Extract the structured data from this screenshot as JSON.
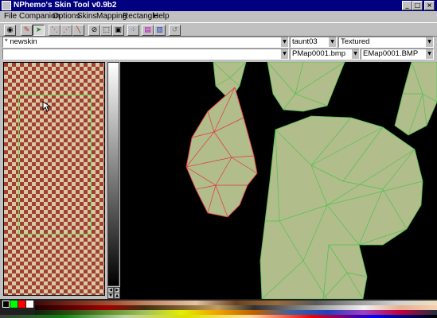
{
  "window": {
    "title": "NPhemo's Skin Tool v0.9b2",
    "minimize_glyph": "_",
    "maximize_glyph": "□",
    "close_glyph": "×"
  },
  "menu": [
    "File",
    "Companion",
    "Options",
    "Skins",
    "Mapping",
    "Rectangle",
    "Help"
  ],
  "toolbar": {
    "buttons": [
      {
        "name": "view-eye-icon",
        "glyph": "◉"
      },
      {
        "name": "paint-tool-icon",
        "glyph": "✎"
      },
      {
        "name": "select-arrow-icon",
        "glyph": "➤"
      },
      {
        "name": "vertex-tool-icon",
        "glyph": "⋱"
      },
      {
        "name": "move-vertex-icon",
        "glyph": "⋰"
      },
      {
        "name": "line-tool-icon",
        "glyph": "╲"
      },
      {
        "name": "link-tool-icon",
        "glyph": "⊘"
      },
      {
        "name": "marquee-icon",
        "glyph": "⬚"
      },
      {
        "name": "image-icon",
        "glyph": "▣"
      },
      {
        "name": "color-picker-icon",
        "glyph": "⁘"
      },
      {
        "name": "front-view-icon",
        "glyph": "▤"
      },
      {
        "name": "back-view-icon",
        "glyph": "▥"
      },
      {
        "name": "reset-icon",
        "glyph": "↺"
      }
    ]
  },
  "skin_selector": {
    "value": "* newskin"
  },
  "frame_selector": {
    "value": "taunt03"
  },
  "render_mode": {
    "value": "Textured"
  },
  "blank_combo": {
    "value": ""
  },
  "pmap_selector": {
    "value": "PMap0001.bmp"
  },
  "emap_selector": {
    "value": "EMap0001.BMP"
  },
  "colors": {
    "mesh_green": "#4ec24e",
    "mesh_fill": "#b2bd8c",
    "selected_red": "#e03838",
    "checker_red": "#a24030",
    "checker_tan": "#d8c8a8",
    "uv_rect_green": "#5ce04a",
    "titlebar": "#000080"
  }
}
